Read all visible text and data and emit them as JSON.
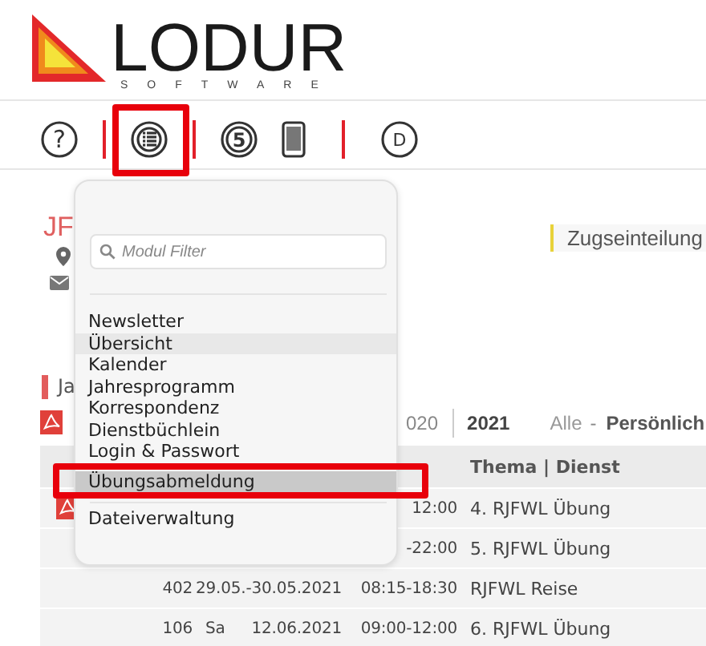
{
  "header": {
    "logo_title": "LODUR",
    "logo_subtitle": "SOFTWARE"
  },
  "toolbar": {
    "groups": [
      [
        {
          "kind": "help",
          "text": "?",
          "annotated": false
        }
      ],
      [
        {
          "kind": "list",
          "annotated": true
        }
      ],
      [
        {
          "kind": "refresh",
          "text": "5",
          "annotated": false
        },
        {
          "kind": "phone",
          "annotated": false
        }
      ],
      [
        {
          "kind": "letter",
          "text": "D",
          "annotated": false
        }
      ]
    ]
  },
  "profile": {
    "name": "JF"
  },
  "notice": {
    "text": "Zugseinteilung"
  },
  "section": {
    "title": "Ja"
  },
  "year_tabs": [
    {
      "label": "020",
      "selected": false
    },
    {
      "label": "2021",
      "selected": true
    }
  ],
  "filters": [
    {
      "label": "Alle",
      "selected": false
    },
    {
      "label": "Persönlich",
      "selected": true
    }
  ],
  "filter_separator": "-",
  "table": {
    "columns": [
      {
        "label": "Thema | Dienst"
      }
    ],
    "rows": [
      {
        "number": "",
        "day": "",
        "date": "",
        "time": "12:00",
        "topic": "4. RJFWL Übung",
        "pdf": true
      },
      {
        "number": "",
        "day": "",
        "date": "",
        "time": "-22:00",
        "topic": "5. RJFWL Übung",
        "pdf": false
      },
      {
        "number": "402",
        "day": "",
        "date": "29.05.-30.05.2021",
        "time": "08:15-18:30",
        "topic": "RJFWL Reise",
        "pdf": false
      },
      {
        "number": "106",
        "day": "Sa",
        "date": "12.06.2021",
        "time": "09:00-12:00",
        "topic": "6. RJFWL Übung",
        "pdf": false
      }
    ]
  },
  "module_menu": {
    "filter": {
      "placeholder": "Modul Filter"
    },
    "sections": [
      {
        "items": [
          {
            "label": "Newsletter",
            "selected": false,
            "hovered": false,
            "annotated": false
          },
          {
            "label": "Übersicht",
            "selected": false,
            "hovered": true,
            "annotated": false
          },
          {
            "label": "Kalender",
            "selected": false,
            "hovered": false,
            "annotated": false
          },
          {
            "label": "Jahresprogramm",
            "selected": false,
            "hovered": false,
            "annotated": false
          },
          {
            "label": "Korrespondenz",
            "selected": false,
            "hovered": false,
            "annotated": false
          },
          {
            "label": "Dienstbüchlein",
            "selected": false,
            "hovered": false,
            "annotated": false
          },
          {
            "label": "Login & Passwort",
            "selected": false,
            "hovered": false,
            "annotated": false
          },
          {
            "label": "Übungsabmeldung",
            "selected": true,
            "hovered": false,
            "annotated": true
          }
        ]
      },
      {
        "items": [
          {
            "label": "Dateiverwaltung",
            "selected": false,
            "hovered": false,
            "annotated": false
          }
        ]
      }
    ]
  }
}
